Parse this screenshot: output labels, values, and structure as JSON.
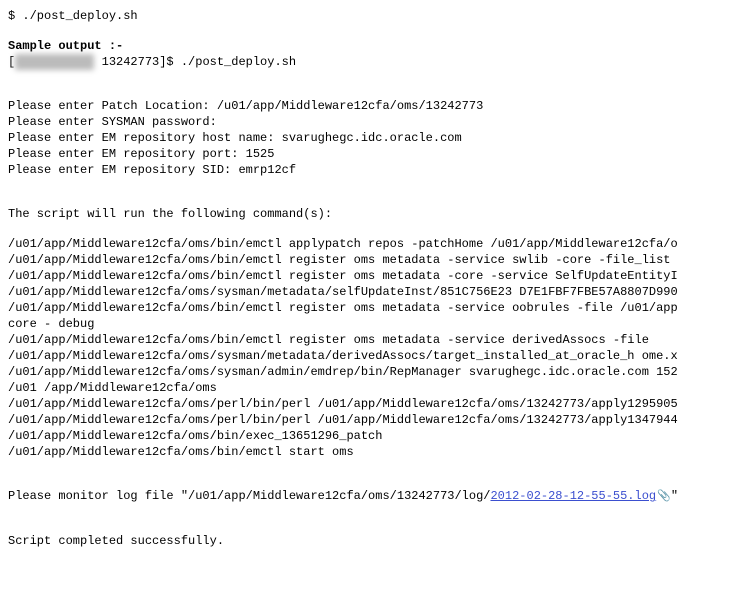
{
  "cmdline": "$ ./post_deploy.sh",
  "sample_label": "Sample output :-",
  "prompt_prefix": "[",
  "redacted_hostinfo": "oracle@host  ",
  "prompt_tail": " 13242773]$ ./post_deploy.sh",
  "prompts": [
    "Please enter Patch Location: /u01/app/Middleware12cfa/oms/13242773",
    "Please enter SYSMAN password:",
    "Please enter EM repository host name: svarughegc.idc.oracle.com",
    "Please enter EM repository port: 1525",
    "Please enter EM repository SID: emrp12cf"
  ],
  "script_header": "The script will run the following command(s):",
  "commands": [
    "/u01/app/Middleware12cfa/oms/bin/emctl applypatch repos -patchHome /u01/app/Middleware12cfa/o",
    "/u01/app/Middleware12cfa/oms/bin/emctl register oms metadata -service swlib -core -file_list ",
    "/u01/app/Middleware12cfa/oms/bin/emctl register oms metadata -core -service SelfUpdateEntityI",
    "/u01/app/Middleware12cfa/oms/sysman/metadata/selfUpdateInst/851C756E23 D7E1FBF7FBE57A8807D990",
    "/u01/app/Middleware12cfa/oms/bin/emctl register oms metadata -service oobrules -file /u01/app",
    "core - debug",
    "/u01/app/Middleware12cfa/oms/bin/emctl register oms metadata -service derivedAssocs -file",
    "/u01/app/Middleware12cfa/oms/sysman/metadata/derivedAssocs/target_installed_at_oracle_h ome.x",
    "/u01/app/Middleware12cfa/oms/sysman/admin/emdrep/bin/RepManager svarughegc.idc.oracle.com 152",
    "/u01 /app/Middleware12cfa/oms",
    "/u01/app/Middleware12cfa/oms/perl/bin/perl /u01/app/Middleware12cfa/oms/13242773/apply1295905",
    "/u01/app/Middleware12cfa/oms/perl/bin/perl /u01/app/Middleware12cfa/oms/13242773/apply1347944",
    "/u01/app/Middleware12cfa/oms/bin/exec_13651296_patch",
    "/u01/app/Middleware12cfa/oms/bin/emctl start oms"
  ],
  "monitor_prefix": "Please monitor log file \"/u01/app/Middleware12cfa/oms/13242773/log/",
  "monitor_link_text": "2012-02-28-12-55-55.log",
  "monitor_suffix": "\"",
  "attach_icon": "📎",
  "completed": "Script completed successfully."
}
